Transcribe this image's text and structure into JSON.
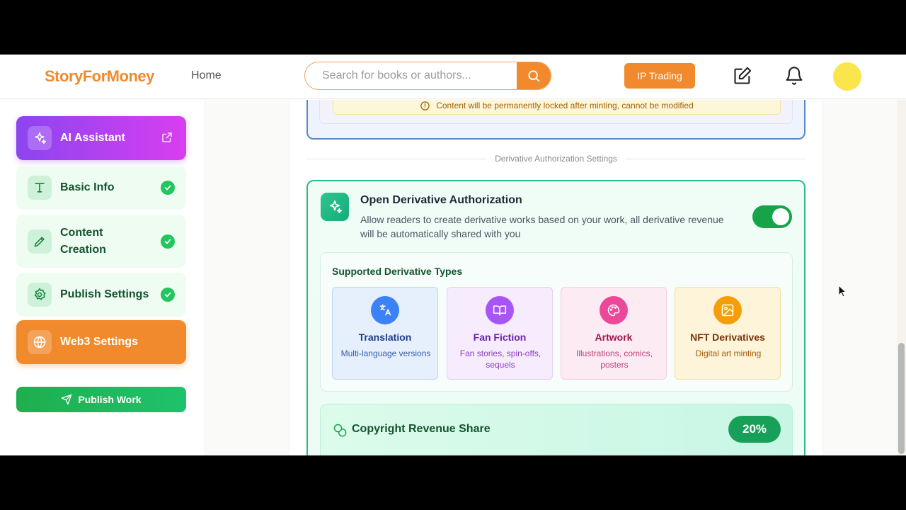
{
  "header": {
    "logo": "StoryForMoney",
    "nav_home": "Home",
    "search_placeholder": "Search for books or authors...",
    "ip_trading": "IP Trading",
    "brand_color": "#f08a2c"
  },
  "sidebar": {
    "items": [
      {
        "label": "AI Assistant",
        "icon": "sparkles-icon",
        "state": "external-link"
      },
      {
        "label": "Basic Info",
        "icon": "text-icon",
        "state": "complete"
      },
      {
        "label": "Content Creation",
        "icon": "pen-tool-icon",
        "state": "complete"
      },
      {
        "label": "Publish Settings",
        "icon": "gear-icon",
        "state": "complete"
      },
      {
        "label": "Web3 Settings",
        "icon": "globe-icon",
        "state": "active"
      }
    ],
    "publish_label": "Publish Work"
  },
  "main": {
    "warning": "Content will be permanently locked after minting, cannot be modified",
    "divider_label": "Derivative Authorization Settings",
    "derivative": {
      "title": "Open Derivative Authorization",
      "description": "Allow readers to create derivative works based on your work, all derivative revenue will be automatically shared with you",
      "enabled": true,
      "types_title": "Supported Derivative Types",
      "types": [
        {
          "name": "Translation",
          "desc": "Multi-language versions",
          "icon": "translate-icon",
          "color": "#3b82f6"
        },
        {
          "name": "Fan Fiction",
          "desc": "Fan stories, spin-offs, sequels",
          "icon": "book-open-icon",
          "color": "#a855f7"
        },
        {
          "name": "Artwork",
          "desc": "Illustrations, comics, posters",
          "icon": "palette-icon",
          "color": "#ec4899"
        },
        {
          "name": "NFT Derivatives",
          "desc": "Digital art minting",
          "icon": "image-icon",
          "color": "#f59e0b"
        }
      ],
      "revenue_title": "Copyright Revenue Share",
      "revenue_share": "20%"
    }
  }
}
